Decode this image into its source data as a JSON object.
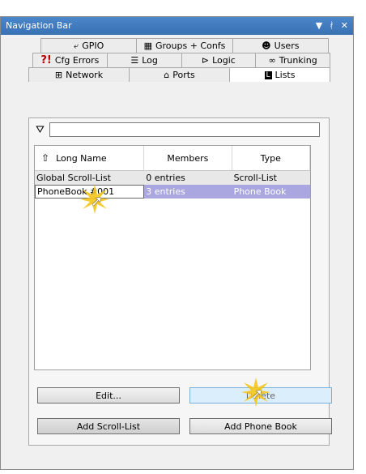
{
  "window": {
    "title": "Navigation Bar",
    "controls": {
      "dropdown": "▼",
      "pin": "ᚯ",
      "close": "✕"
    }
  },
  "tabs": {
    "row1": [
      {
        "label": "GPIO",
        "icon": "gpio-icon"
      },
      {
        "label": "Groups + Confs",
        "icon": "groups-icon"
      },
      {
        "label": "Users",
        "icon": "users-icon"
      }
    ],
    "row2": [
      {
        "label": "Cfg Errors",
        "icon": "cfg-errors-icon"
      },
      {
        "label": "Log",
        "icon": "log-icon"
      },
      {
        "label": "Logic",
        "icon": "logic-icon"
      },
      {
        "label": "Trunking",
        "icon": "trunking-icon"
      }
    ],
    "row3": [
      {
        "label": "Network",
        "icon": "network-icon"
      },
      {
        "label": "Ports",
        "icon": "ports-icon"
      },
      {
        "label": "Lists",
        "icon": "lists-icon",
        "active": true
      }
    ]
  },
  "filter": {
    "value": ""
  },
  "table": {
    "headers": [
      "Long Name",
      "Members",
      "Type"
    ],
    "rows": [
      [
        "Global Scroll-List",
        "0 entries",
        "Scroll-List"
      ],
      [
        "PhoneBook #001",
        "3 entries",
        "Phone Book"
      ]
    ]
  },
  "buttons": {
    "edit": "Edit...",
    "delete": "Delete",
    "add_scroll": "Add Scroll-List",
    "add_phone": "Add Phone Book"
  },
  "colors": {
    "title_bar": "#3a72b4",
    "selected_row": "#a9a6e0",
    "highlight_burst": "#f5c518"
  }
}
